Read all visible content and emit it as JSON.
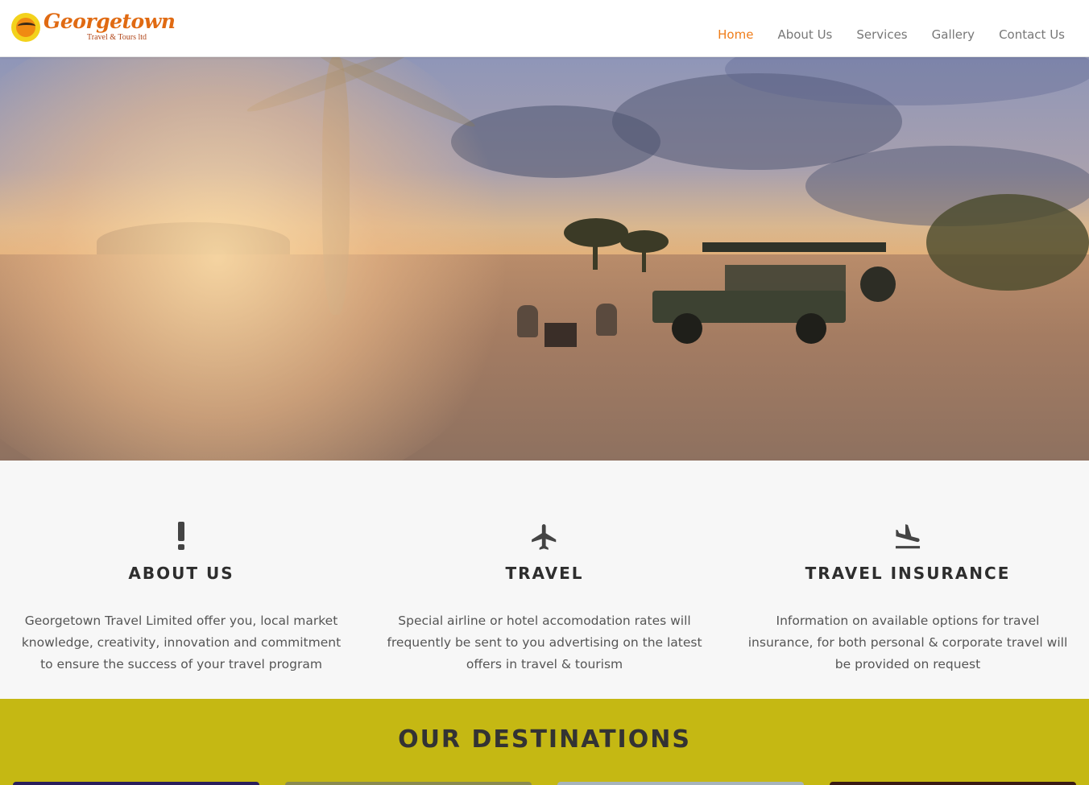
{
  "brand": {
    "name": "Georgetown",
    "tagline": "Travel & Tours ltd"
  },
  "nav": {
    "items": [
      {
        "label": "Home",
        "active": true
      },
      {
        "label": "About Us",
        "active": false
      },
      {
        "label": "Services",
        "active": false
      },
      {
        "label": "Gallery",
        "active": false
      },
      {
        "label": "Contact Us",
        "active": false
      }
    ]
  },
  "hero": {
    "image": "safari-sunset-landscape"
  },
  "features": [
    {
      "icon": "exclamation-icon",
      "title": "ABOUT US",
      "text": "Georgetown Travel Limited offer you, local market knowledge, creativity, innovation and commitment to ensure the success of your travel program"
    },
    {
      "icon": "airplane-icon",
      "title": "TRAVEL",
      "text": "Special airline or hotel accomodation rates will frequently be sent to you advertising on the latest offers in travel & tourism"
    },
    {
      "icon": "plane-landing-icon",
      "title": "TRAVEL INSURANCE",
      "text": "Information on available options for travel insurance, for both personal & corporate travel will be provided on request"
    }
  ],
  "destinations": {
    "title": "OUR DESTINATIONS"
  },
  "colors": {
    "accent": "#ef7d1a",
    "destinations_bg": "#c5b813",
    "features_bg": "#f7f7f7"
  }
}
